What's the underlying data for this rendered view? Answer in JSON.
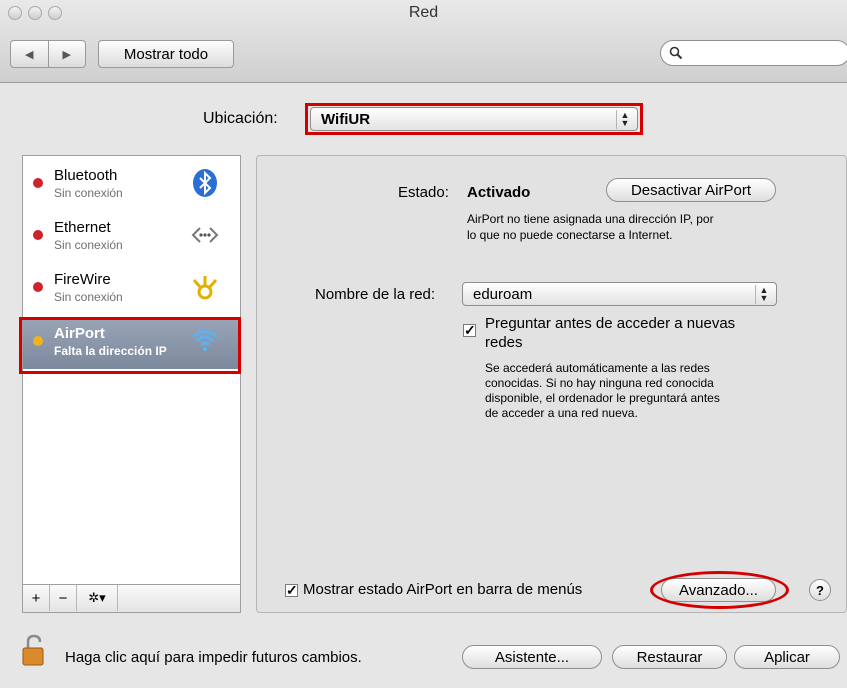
{
  "window": {
    "title": "Red"
  },
  "toolbar": {
    "show_all_label": "Mostrar todo",
    "back_arrow": "◀",
    "forward_arrow": "▶"
  },
  "location": {
    "label": "Ubicación:",
    "value": "WifiUR"
  },
  "services": [
    {
      "name": "Bluetooth",
      "status": "Sin conexión",
      "dot_color": "#d0222a",
      "icon": "bluetooth-icon"
    },
    {
      "name": "Ethernet",
      "status": "Sin conexión",
      "dot_color": "#d0222a",
      "icon": "ethernet-icon"
    },
    {
      "name": "FireWire",
      "status": "Sin conexión",
      "dot_color": "#d0222a",
      "icon": "firewire-icon"
    },
    {
      "name": "AirPort",
      "status": "Falta la dirección IP",
      "dot_color": "#f1b21c",
      "icon": "wifi-icon",
      "selected": true
    }
  ],
  "sidebar_footer": {
    "add": "+",
    "remove": "−",
    "gear": "✲▾"
  },
  "main": {
    "status_label": "Estado:",
    "status_value": "Activado",
    "toggle_button": "Desactivar AirPort",
    "status_desc_line1": "AirPort no tiene asignada una dirección IP, por",
    "status_desc_line2": "lo que no puede conectarse a Internet.",
    "network_label": "Nombre de la red:",
    "network_value": "eduroam",
    "ask_checkbox_label_line1": "Preguntar antes de acceder a nuevas",
    "ask_checkbox_label_line2": "redes",
    "ask_desc_line1": "Se accederá automáticamente a las redes",
    "ask_desc_line2": "conocidas. Si no hay ninguna red conocida",
    "ask_desc_line3": "disponible, el ordenador le preguntará antes",
    "ask_desc_line4": "de acceder a una red nueva.",
    "show_status_label": "Mostrar estado AirPort en barra de menús",
    "advanced_button": "Avanzado...",
    "help": "?",
    "check_mark": "✓"
  },
  "footer": {
    "lock_text": "Haga clic aquí para impedir futuros cambios.",
    "assistant_button": "Asistente...",
    "revert_button": "Restaurar",
    "apply_button": "Aplicar"
  },
  "colors": {
    "highlight": "#d40000",
    "selection": "#8793a5"
  }
}
